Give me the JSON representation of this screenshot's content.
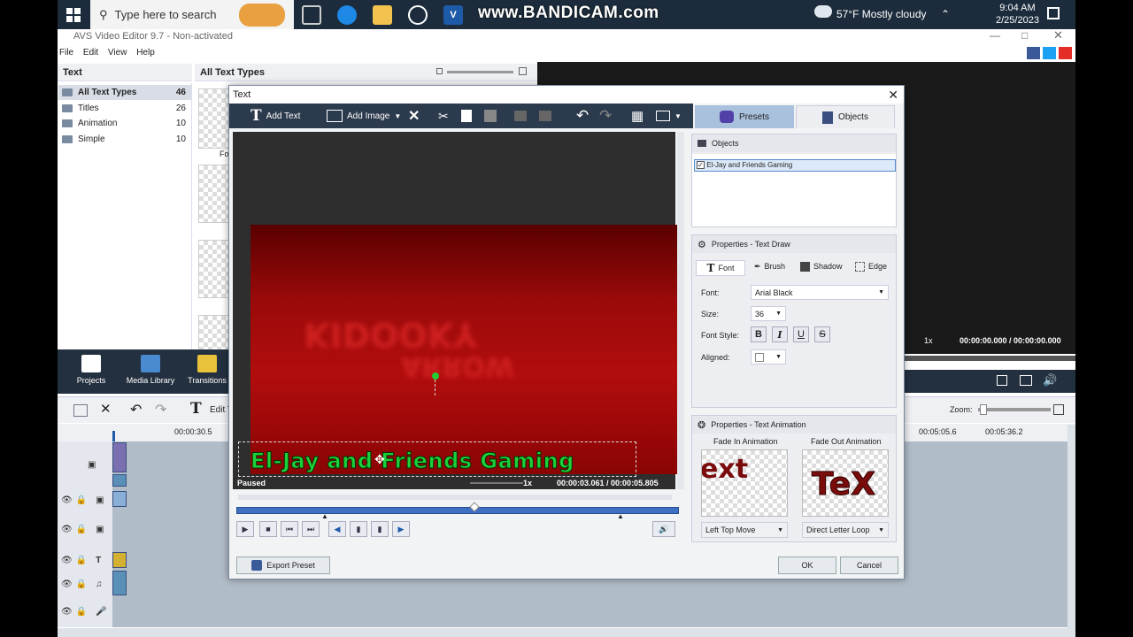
{
  "taskbar": {
    "search_placeholder": "Type here to search",
    "watermark": "www.BANDICAM.com",
    "weather": "57°F  Mostly cloudy",
    "time": "9:04 AM",
    "date": "2/25/2023"
  },
  "app": {
    "title": "AVS Video Editor 9.7 - Non-activated",
    "menu": [
      "File",
      "Edit",
      "View",
      "Help"
    ],
    "left_header": "Text",
    "center_header": "All Text Types",
    "categories": [
      {
        "label": "All Text Types",
        "count": "46"
      },
      {
        "label": "Titles",
        "count": "26"
      },
      {
        "label": "Animation",
        "count": "10"
      },
      {
        "label": "Simple",
        "count": "10"
      }
    ],
    "thumb_first_label": "Fo",
    "tools": [
      "Projects",
      "Media Library",
      "Transitions"
    ],
    "edit_text_label": "Edit T",
    "right_speed": "1x",
    "right_time": "00:00:00.000  /  00:00:00.000",
    "zoom_label": "Zoom:",
    "ruler": [
      "00:00:30.5",
      "00:05:05.6",
      "00:05:36.2"
    ]
  },
  "dialog": {
    "title": "Text",
    "toolbar": {
      "add_text": "Add Text",
      "add_image": "Add Image"
    },
    "tabs": {
      "presets": "Presets",
      "objects": "Objects"
    },
    "objects_header": "Objects",
    "object_item": "El-Jay and Friends Gaming",
    "preview_text": "El-Jay and Friends Gaming",
    "status": "Paused",
    "speed": "1x",
    "time": "00:00:03.061  /  00:00:05.805",
    "properties_draw": "Properties - Text Draw",
    "subtabs": [
      "Font",
      "Brush",
      "Shadow",
      "Edge"
    ],
    "font_label": "Font:",
    "font_value": "Arial Black",
    "size_label": "Size:",
    "size_value": "36",
    "style_label": "Font Style:",
    "style_buttons": [
      "B",
      "I",
      "U",
      "S"
    ],
    "aligned_label": "Aligned:",
    "properties_anim": "Properties - Text Animation",
    "fade_in_label": "Fade In Animation",
    "fade_out_label": "Fade Out Animation",
    "fade_in_sample": "ext",
    "fade_out_sample": "TeX",
    "fade_in_value": "Left Top Move",
    "fade_out_value": "Direct Letter Loop",
    "export_preset": "Export Preset",
    "ok": "OK",
    "cancel": "Cancel"
  },
  "colors": {
    "taskbar": "#1c2c3c",
    "dialog_toolbar": "#2b3a4d",
    "preview_text": "#1dd13a",
    "video_red": "#b20d0d"
  }
}
